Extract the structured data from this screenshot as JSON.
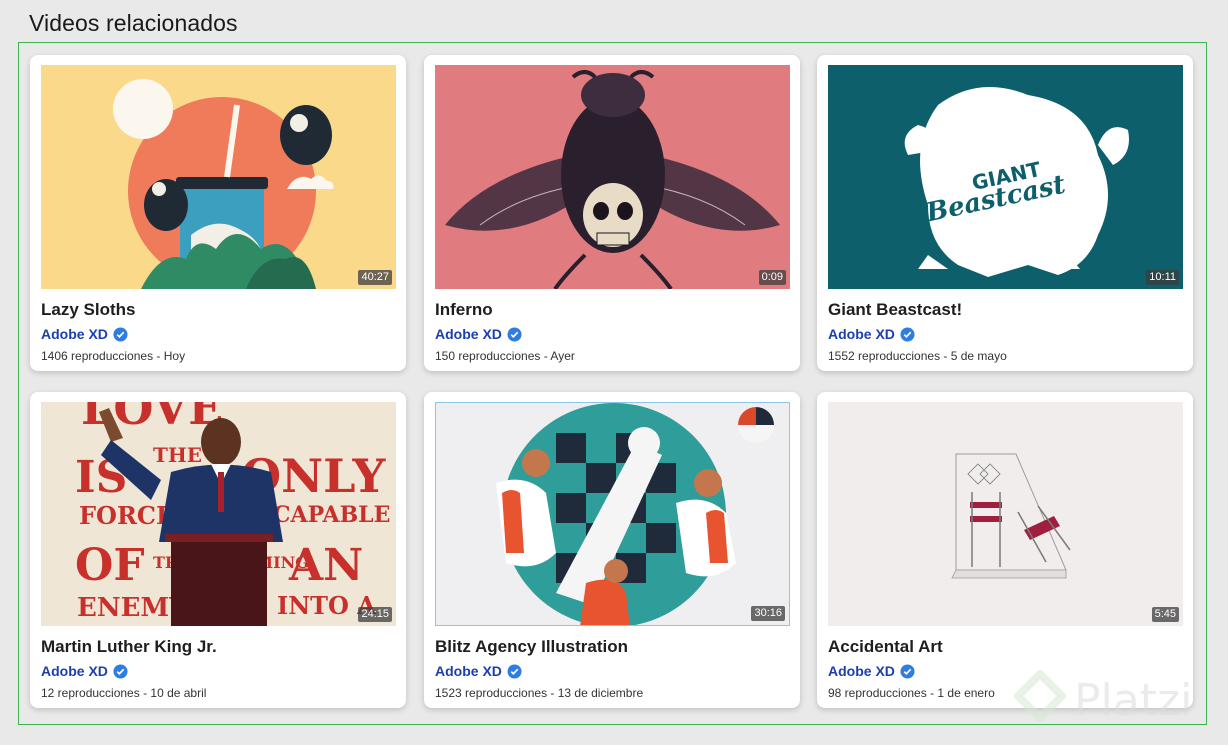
{
  "section_title": "Videos relacionados",
  "verified_color": "#2f7de0",
  "watermark": "Platzi",
  "videos": [
    {
      "title": "Lazy Sloths",
      "channel": "Adobe XD",
      "meta": "1406 reproducciones - Hoy",
      "duration": "40:27"
    },
    {
      "title": "Inferno",
      "channel": "Adobe XD",
      "meta": "150 reproducciones - Ayer",
      "duration": "0:09"
    },
    {
      "title": "Giant Beastcast!",
      "channel": "Adobe XD",
      "meta": "1552 reproducciones - 5 de mayo",
      "duration": "10:11"
    },
    {
      "title": "Martin Luther King Jr.",
      "channel": "Adobe XD",
      "meta": "12 reproducciones - 10 de abril",
      "duration": "24:15"
    },
    {
      "title": "Blitz Agency Illustration",
      "channel": "Adobe XD",
      "meta": "1523 reproducciones - 13 de diciembre",
      "duration": "30:16"
    },
    {
      "title": "Accidental Art",
      "channel": "Adobe XD",
      "meta": "98 reproducciones - 1 de enero",
      "duration": "5:45"
    }
  ],
  "thumbnail_art": {
    "beastcast_text_1": "GIANT",
    "beastcast_text_2": "Beastcast",
    "mlk_words": [
      "LOVE",
      "THE",
      "IS",
      "ONLY",
      "FORCE",
      "CAPABLE",
      "OF",
      "TRANSFORMING",
      "AN",
      "ENEMY",
      "INTO A"
    ]
  }
}
